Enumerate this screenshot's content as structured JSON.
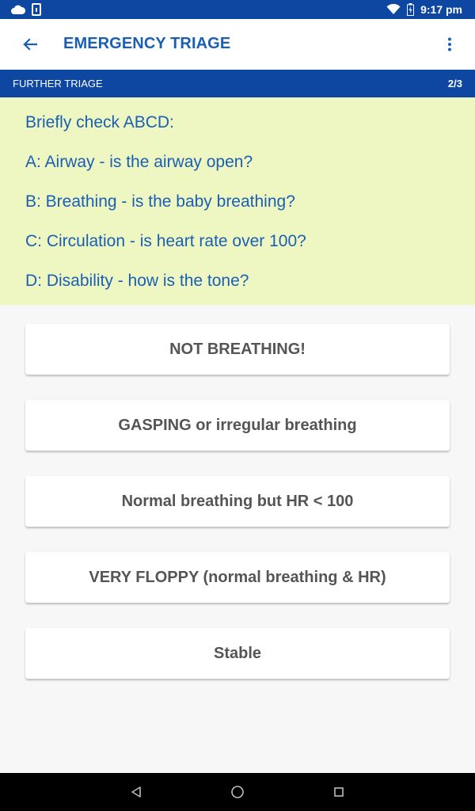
{
  "status_bar": {
    "time": "9:17 pm",
    "icons": [
      "notification-cloud-icon",
      "sim-card-icon",
      "wifi-icon",
      "battery-charging-icon"
    ]
  },
  "app_bar": {
    "title": "EMERGENCY TRIAGE",
    "back_icon": "arrow-back-icon",
    "menu_icon": "more-vert-icon"
  },
  "section": {
    "title": "FURTHER TRIAGE",
    "step": "2/3"
  },
  "info": {
    "lines": [
      "Briefly check ABCD:",
      "A: Airway - is the airway open?",
      "B: Breathing - is the baby breathing?",
      "C: Circulation - is heart rate over 100?",
      "D: Disability - how is the tone?"
    ]
  },
  "options": [
    "NOT BREATHING!",
    "GASPING or irregular breathing",
    "Normal breathing but HR < 100",
    "VERY FLOPPY (normal breathing & HR)",
    "Stable"
  ],
  "nav": {
    "icons": [
      "nav-back-icon",
      "nav-home-icon",
      "nav-recents-icon"
    ]
  },
  "colors": {
    "primary": "#0d47a1",
    "accent_text": "#1a5fb4",
    "info_background": "#eef7c2",
    "option_text": "#555555"
  }
}
